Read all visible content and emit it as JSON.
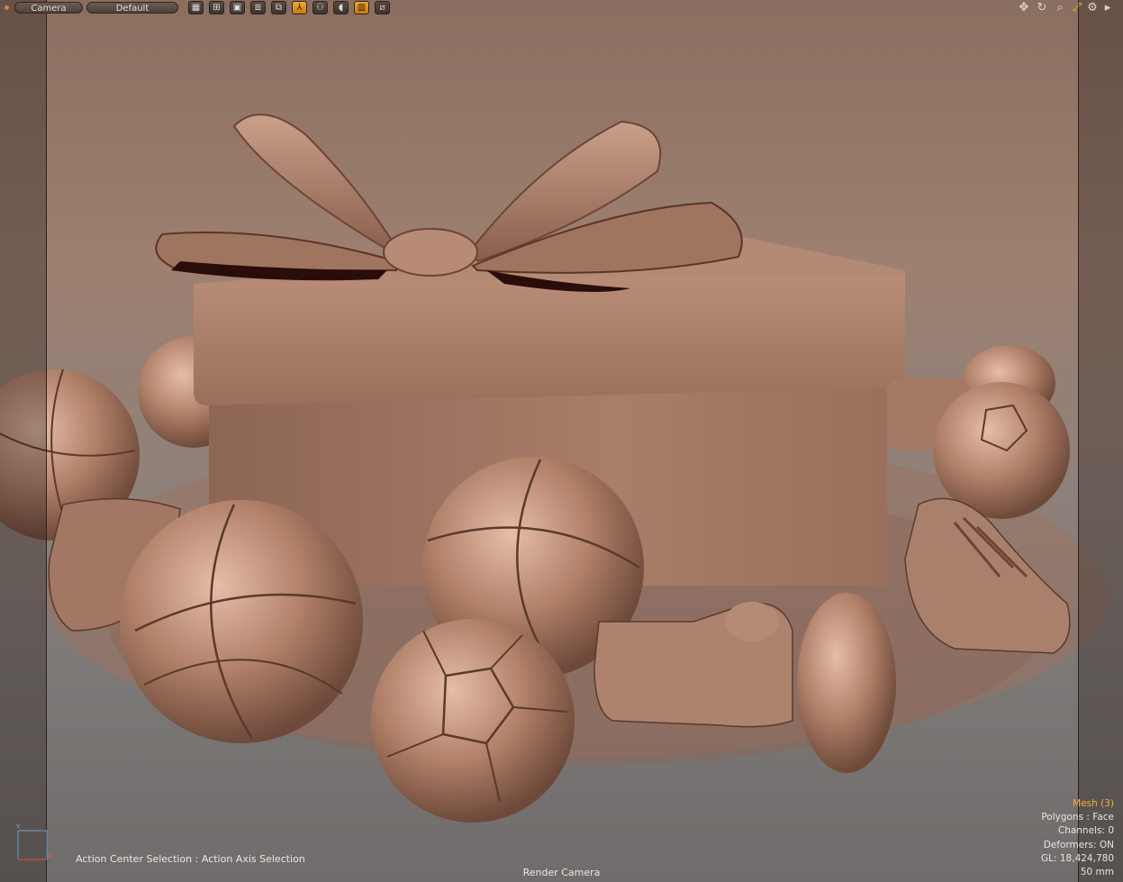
{
  "toolbar": {
    "camera_label": "Camera",
    "preset_label": "Default",
    "accent_color": "#f0a830"
  },
  "viewport_icons": [
    "pan-icon",
    "orbit-icon",
    "zoom-icon",
    "maximize-icon",
    "gear-icon",
    "menu-arrow-icon"
  ],
  "hud": {
    "mesh": "Mesh (3)",
    "polygons": "Polygons : Face",
    "channels": "Channels: 0",
    "deformers": "Deformers: ON",
    "gl": "GL: 18,424,780",
    "focal": "50 mm"
  },
  "status": {
    "action_center": "Action Center Selection : Action Axis Selection",
    "camera": "Render Camera"
  },
  "axis_labels": {
    "y": "Y",
    "x": "X"
  }
}
